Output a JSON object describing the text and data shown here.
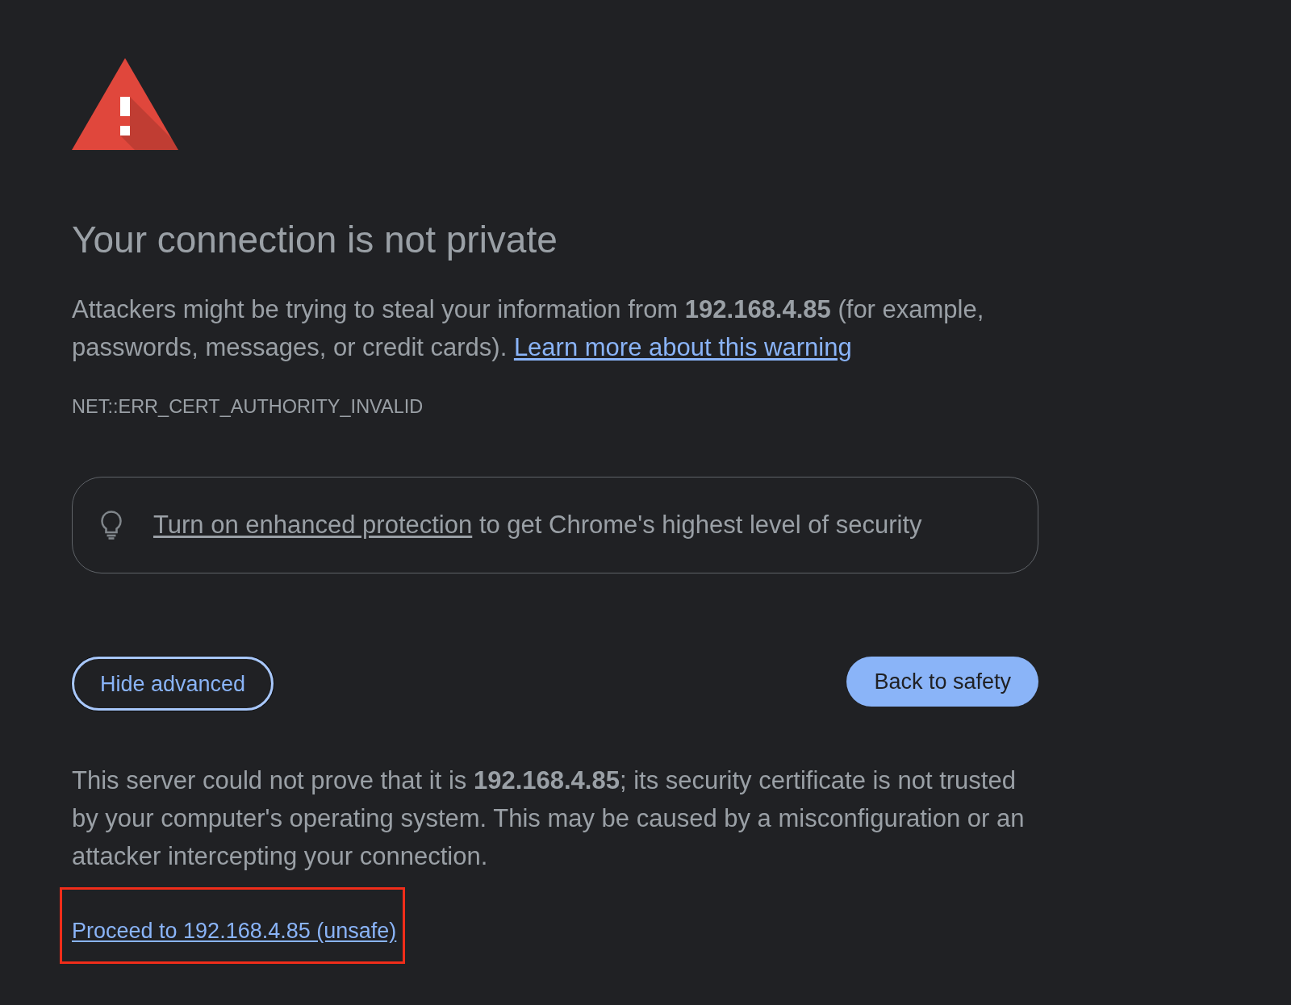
{
  "warning": {
    "title": "Your connection is not private",
    "message": "Attackers might be trying to steal your information from **192.168.4.85** (for example, passwords, messages, or credit cards).",
    "learn_more_link": "Learn more about this warning",
    "error_code": "NET::ERR_CERT_AUTHORITY_INVALID"
  },
  "protection_banner": {
    "link": "Turn on enhanced protection",
    "text": "to get Chrome's highest level of security"
  },
  "buttons": [
    {
      "label": "Hide advanced",
      "kind": "secondary",
      "focused": true
    },
    {
      "label": "Back to safety",
      "kind": "primary",
      "focused": false
    }
  ],
  "details": {
    "text": "This server could not prove that it is **192.168.4.85**; its security certificate is not trusted by your computer's operating system. This may be caused by a misconfiguration or an attacker intercepting your connection.",
    "proceed_link": {
      "label": "Proceed to 192.168.4.85 (unsafe)",
      "highlighted": true
    }
  }
}
